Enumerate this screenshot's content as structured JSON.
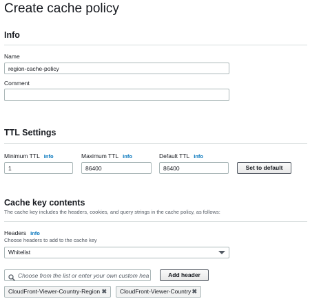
{
  "page": {
    "title": "Create cache policy"
  },
  "info_section": {
    "title": "Info",
    "name_label": "Name",
    "name_value": "region-cache-policy",
    "comment_label": "Comment",
    "comment_value": ""
  },
  "ttl_section": {
    "title": "TTL Settings",
    "min_label": "Minimum TTL",
    "min_value": "1",
    "max_label": "Maximum TTL",
    "max_value": "86400",
    "default_label": "Default TTL",
    "default_value": "86400",
    "info_link": "Info",
    "set_default_button": "Set to default"
  },
  "cache_key_section": {
    "title": "Cache key contents",
    "description": "The cache key includes the headers, cookies, and query strings in the cache policy, as follows:",
    "headers_label": "Headers",
    "headers_info": "Info",
    "headers_desc": "Choose headers to add to the cache key",
    "headers_select_value": "Whitelist",
    "search_placeholder": "Choose from the list or enter your own custom header",
    "add_header_button": "Add header",
    "tokens": [
      {
        "label": "CloudFront-Viewer-Country-Region"
      },
      {
        "label": "CloudFront-Viewer-Country"
      }
    ]
  },
  "icons": {
    "search": "search-icon",
    "dropdown": "caret-down-icon",
    "remove": "close-icon"
  },
  "colors": {
    "link": "#0073bb",
    "border": "#aab7b8",
    "divider": "#d5dbdb",
    "text": "#16191f"
  }
}
